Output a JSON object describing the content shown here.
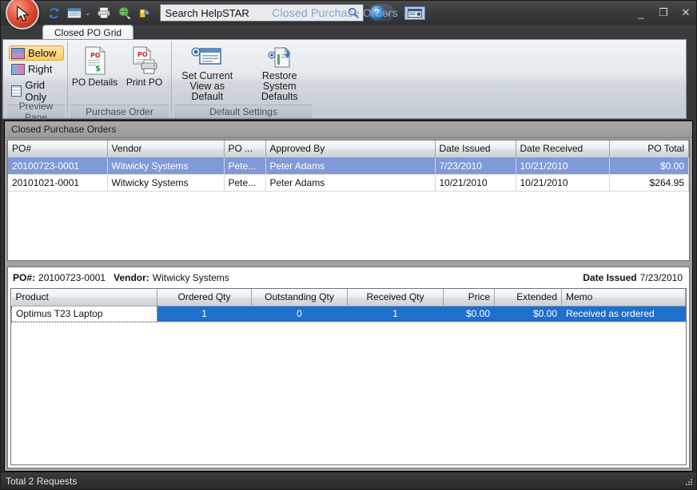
{
  "window": {
    "title": "Closed Purchase Orders",
    "minimize_label": "_",
    "maximize_label": "❐",
    "close_label": "✕"
  },
  "quick_access": {
    "items": [
      {
        "name": "refresh-icon",
        "label": "Refresh"
      },
      {
        "name": "window-list-icon",
        "label": "Windows"
      },
      {
        "name": "print-icon",
        "label": "Print"
      },
      {
        "name": "globe-icon",
        "label": "Web"
      },
      {
        "name": "tools-icon",
        "label": "Tools"
      }
    ],
    "customize_caret": "⌄"
  },
  "search": {
    "value": "Search HelpSTAR",
    "placeholder": "Search HelpSTAR",
    "icon": "search-icon"
  },
  "help": {
    "label": "?",
    "caret": "⌄",
    "minimize_ribbon": "⌄"
  },
  "tabs": [
    {
      "label": "Closed PO Grid",
      "active": true
    }
  ],
  "ribbon": {
    "groups": [
      {
        "title": "Preview Pane",
        "items": [
          {
            "label": "Below",
            "icon": "preview-below-icon",
            "active": true
          },
          {
            "label": "Right",
            "icon": "preview-right-icon",
            "active": false
          },
          {
            "label": "Grid Only",
            "icon": "preview-gridonly-icon",
            "active": false
          }
        ]
      },
      {
        "title": "Purchase Order",
        "items": [
          {
            "label": "PO Details",
            "icon": "po-details-icon"
          },
          {
            "label": "Print PO",
            "icon": "print-po-icon"
          }
        ]
      },
      {
        "title": "Default Settings",
        "items": [
          {
            "label": "Set Current View as Default",
            "icon": "set-default-view-icon"
          },
          {
            "label": "Restore System Defaults",
            "icon": "restore-defaults-icon"
          }
        ]
      }
    ]
  },
  "panel": {
    "caption": "Closed Purchase Orders"
  },
  "po_grid": {
    "columns": [
      "PO#",
      "Vendor",
      "PO ...",
      "Approved By",
      "Date Issued",
      "Date Received",
      "PO Total"
    ],
    "rows": [
      {
        "po": "20100723-0001",
        "vendor": "Witwicky Systems",
        "po_trunc": "Pete...",
        "approved_by": "Peter Adams",
        "date_issued": "7/23/2010",
        "date_received": "10/21/2010",
        "po_total": "$0.00",
        "selected": true
      },
      {
        "po": "20101021-0001",
        "vendor": "Witwicky Systems",
        "po_trunc": "Pete...",
        "approved_by": "Peter Adams",
        "date_issued": "10/21/2010",
        "date_received": "10/21/2010",
        "po_total": "$264.95",
        "selected": false
      }
    ]
  },
  "detail": {
    "po_label": "PO#:",
    "po_value": "20100723-0001",
    "vendor_label": "Vendor:",
    "vendor_value": "Witwicky Systems",
    "date_issued_label": "Date Issued",
    "date_issued_value": "7/23/2010",
    "columns": [
      "Product",
      "Ordered Qty",
      "Outstanding Qty",
      "Received Qty",
      "Price",
      "Extended",
      "Memo"
    ],
    "rows": [
      {
        "product": "Optimus T23 Laptop",
        "ordered_qty": "1",
        "outstanding_qty": "0",
        "received_qty": "1",
        "price": "$0.00",
        "extended": "$0.00",
        "memo": "Received as ordered",
        "selected": true
      }
    ]
  },
  "statusbar": {
    "text": "Total 2 Requests"
  },
  "colors": {
    "accent_selection_top": "#8099d8",
    "accent_selection_bottom": "#1f6fce",
    "title_text": "#7fa7d6",
    "active_button": "#ffcb63"
  }
}
